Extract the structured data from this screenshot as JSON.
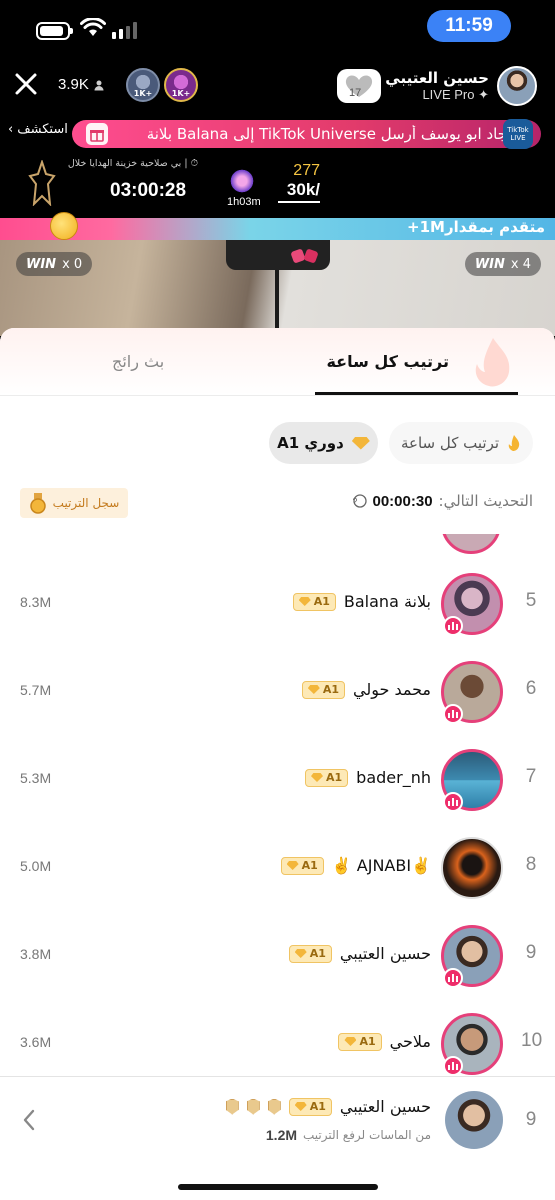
{
  "status": {
    "time": "11:59",
    "battery_level": 0.75,
    "signal_bars": 2
  },
  "header": {
    "viewers": "3.9K",
    "gift_badge_1": "1K+",
    "gift_badge_2": "1K+",
    "host_name": "حسين العتيبي",
    "host_subtitle": "LIVE Pro",
    "follow_chip_number": "17"
  },
  "banner": {
    "explore_label": "استكشف",
    "text": "جاد ابو يوسف أرسل TikTok Universe إلى Balana بلانة",
    "logo_text": "TikTok LIVE"
  },
  "timers": {
    "treasure_text": "بي صلاحية خزينة الهدايا خلال",
    "countdown": "03:00:28",
    "live_duration": "1h03m",
    "score": "277",
    "goal": "30k/"
  },
  "battle": {
    "lead_text": "متقدم بمقدار1M+",
    "left_win_label": "WIN",
    "left_win_count": "x 0",
    "right_win_label": "WIN",
    "right_win_count": "x 4"
  },
  "tabs": {
    "active": "ترتيب كل ساعة",
    "inactive": "بث رائج"
  },
  "chips": {
    "hourly": "ترتيب كل ساعة",
    "league": "دوري A1"
  },
  "update": {
    "label": "التحديث التالي:",
    "time": "00:00:30",
    "history_button": "سجل الترتيب"
  },
  "badge_label": "A1",
  "rankings": [
    {
      "rank": "5",
      "name": "بلانة Balana",
      "score": "8.3M"
    },
    {
      "rank": "6",
      "name": "محمد حولي",
      "score": "5.7M"
    },
    {
      "rank": "7",
      "name": "bader_nh",
      "score": "5.3M"
    },
    {
      "rank": "8",
      "name": "✌️AJNABI ✌️",
      "score": "5.0M"
    },
    {
      "rank": "9",
      "name": "حسين العتيبي",
      "score": "3.8M"
    },
    {
      "rank": "10",
      "name": "ملاحي",
      "score": "3.6M"
    }
  ],
  "my_rank": {
    "rank": "9",
    "name": "حسين العتيبي",
    "score": "1.2M",
    "hint": "من الماسات لرفع الترتيب"
  },
  "colors": {
    "accent_pink": "#e5407a",
    "clock_blue": "#3b82f6",
    "gold": "#f3b63a"
  }
}
